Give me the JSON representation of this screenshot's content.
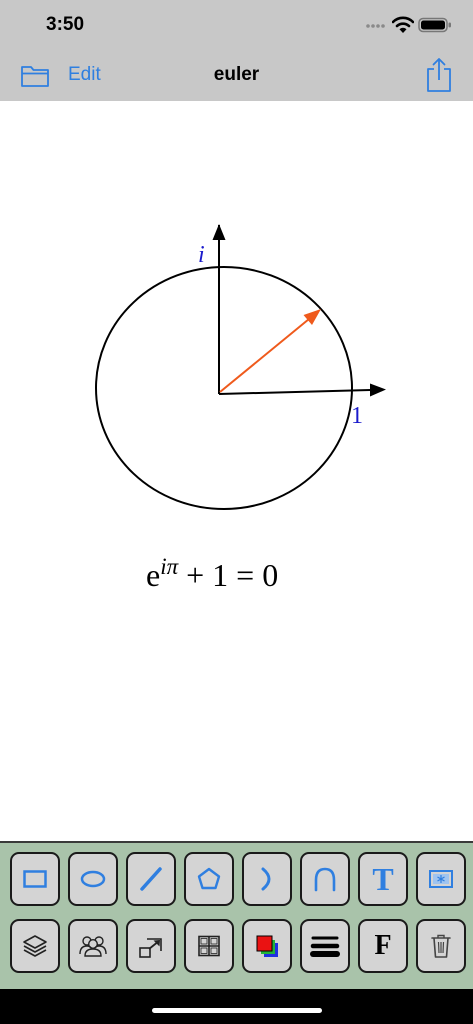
{
  "status_bar": {
    "time": "3:50"
  },
  "nav": {
    "folder_icon": "folder-icon",
    "edit_label": "Edit",
    "title": "euler",
    "share_icon": "share-icon"
  },
  "drawing": {
    "imag_axis_label": "i",
    "real_axis_label": "1",
    "equation_base": "e",
    "equation_exponent": "iπ",
    "equation_rest": " + 1 = 0",
    "colors": {
      "axes": "#000000",
      "vector": "#ef5a1c",
      "axis_labels": "#1a1acc"
    }
  },
  "toolbox": {
    "row1": [
      {
        "icon": "rectangle-tool-icon"
      },
      {
        "icon": "ellipse-tool-icon"
      },
      {
        "icon": "line-tool-icon"
      },
      {
        "icon": "polygon-tool-icon"
      },
      {
        "icon": "arc-tool-icon"
      },
      {
        "icon": "curve-tool-icon"
      },
      {
        "icon": "text-tool-icon",
        "label": "T"
      },
      {
        "icon": "image-tool-icon"
      }
    ],
    "row2": [
      {
        "icon": "layers-icon"
      },
      {
        "icon": "group-icon"
      },
      {
        "icon": "resize-icon"
      },
      {
        "icon": "grid-icon"
      },
      {
        "icon": "color-icon"
      },
      {
        "icon": "line-weight-icon"
      },
      {
        "icon": "font-icon",
        "label": "F"
      },
      {
        "icon": "trash-icon"
      }
    ],
    "colors": {
      "background": "#a9c3aa",
      "button": "#d4d4d4",
      "accent": "#2f7fe0"
    }
  }
}
